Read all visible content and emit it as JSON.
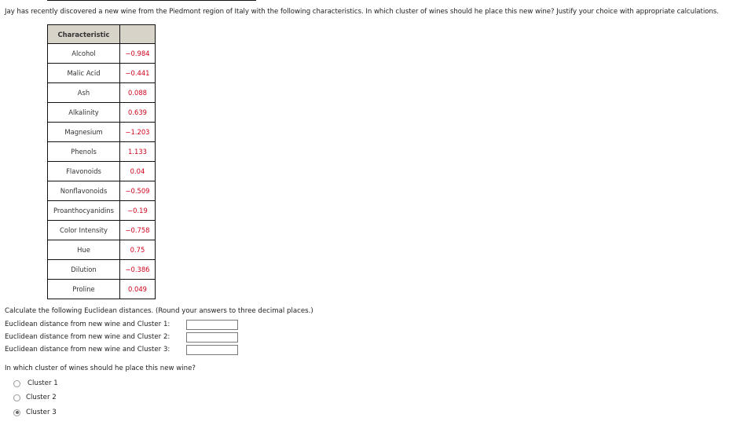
{
  "question": "Jay has recently discovered a new wine from the Piedmont region of Italy with the following characteristics. In which cluster of wines should he place this new wine? Justify your choice with appropriate calculations.",
  "table": {
    "header": {
      "label": "Characteristic",
      "value": ""
    },
    "rows": [
      {
        "label": "Alcohol",
        "value": "−0.984"
      },
      {
        "label": "Malic Acid",
        "value": "−0.441"
      },
      {
        "label": "Ash",
        "value": "0.088"
      },
      {
        "label": "Alkalinity",
        "value": "0.639"
      },
      {
        "label": "Magnesium",
        "value": "−1.203"
      },
      {
        "label": "Phenols",
        "value": "1.133"
      },
      {
        "label": "Flavonoids",
        "value": "0.04"
      },
      {
        "label": "Nonflavonoids",
        "value": "−0.509"
      },
      {
        "label": "Proanthocyanidins",
        "value": "−0.19"
      },
      {
        "label": "Color Intensity",
        "value": "−0.758"
      },
      {
        "label": "Hue",
        "value": "0.75"
      },
      {
        "label": "Dilution",
        "value": "−0.386"
      },
      {
        "label": "Proline",
        "value": "0.049"
      }
    ]
  },
  "calc_instruction": "Calculate the following Euclidean distances. (Round your answers to three decimal places.)",
  "distances": [
    {
      "label": "Euclidean distance from new wine and Cluster 1:",
      "value": ""
    },
    {
      "label": "Euclidean distance from new wine and Cluster 2:",
      "value": ""
    },
    {
      "label": "Euclidean distance from new wine and Cluster 3:",
      "value": ""
    }
  ],
  "placement_question": "In which cluster of wines should he place this new wine?",
  "options": [
    {
      "label": "Cluster 1",
      "selected": false
    },
    {
      "label": "Cluster 2",
      "selected": false
    },
    {
      "label": "Cluster 3",
      "selected": true
    }
  ],
  "colors": {
    "value_text": "#d0021b",
    "header_bg": "#d7d3c9"
  }
}
